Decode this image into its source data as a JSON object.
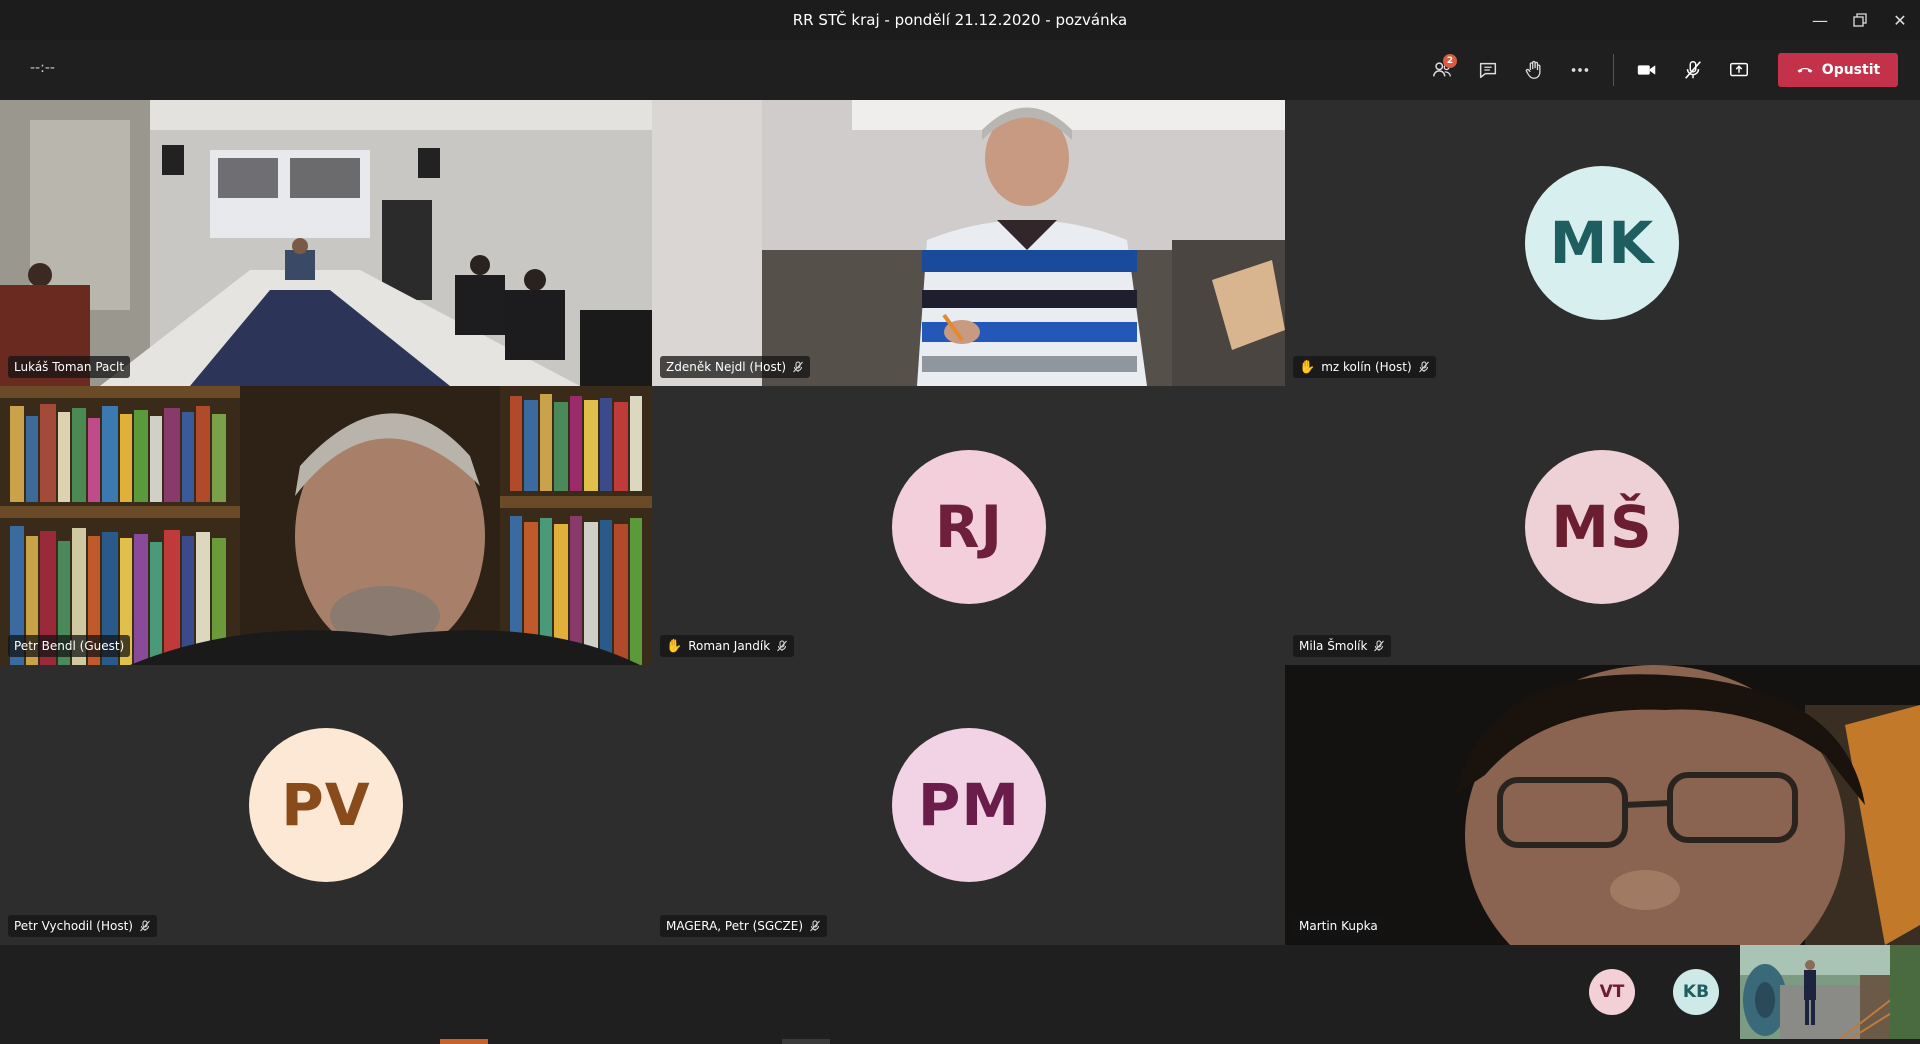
{
  "window": {
    "title": "RR STČ kraj - pondělí 21.12.2020 - pozvánka"
  },
  "toolbar": {
    "timer": "--:--",
    "participants_badge": "2",
    "leave_label": "Opustit",
    "leave_color": "#c4314b"
  },
  "tiles": [
    {
      "name": "Lukáš Toman Paclt",
      "type": "video"
    },
    {
      "name": "Zdeněk Nejdl (Host)",
      "type": "video",
      "muted": true
    },
    {
      "name": "mz kolín (Host)",
      "type": "avatar",
      "initials": "MK",
      "hand_raised": true,
      "muted": true,
      "bg": "#d8eff0",
      "fg": "#1e5e60"
    },
    {
      "name": "Petr Bendl (Guest)",
      "type": "video"
    },
    {
      "name": "Roman Jandík",
      "type": "avatar",
      "initials": "RJ",
      "hand_raised": true,
      "muted": true,
      "bg": "#f3cfdb",
      "fg": "#6e1f3c"
    },
    {
      "name": "Mila Šmolík",
      "type": "avatar",
      "initials": "MŠ",
      "muted": true,
      "bg": "#eed1d6",
      "fg": "#6b1e30"
    },
    {
      "name": "Petr Vychodil (Host)",
      "type": "avatar",
      "initials": "PV",
      "muted": true,
      "bg": "#fce8d4",
      "fg": "#8a4b1b"
    },
    {
      "name": "MAGERA, Petr (SGCZE)",
      "type": "avatar",
      "initials": "PM",
      "muted": true,
      "bg": "#f2d3e6",
      "fg": "#6a1c4a"
    },
    {
      "name": "Martin Kupka",
      "type": "video"
    }
  ],
  "strip": {
    "participants": [
      {
        "initials": "VT",
        "bg": "#f2d0d6",
        "fg": "#6b1e30"
      },
      {
        "initials": "KB",
        "bg": "#cfe9e9",
        "fg": "#1e5e60"
      }
    ]
  }
}
